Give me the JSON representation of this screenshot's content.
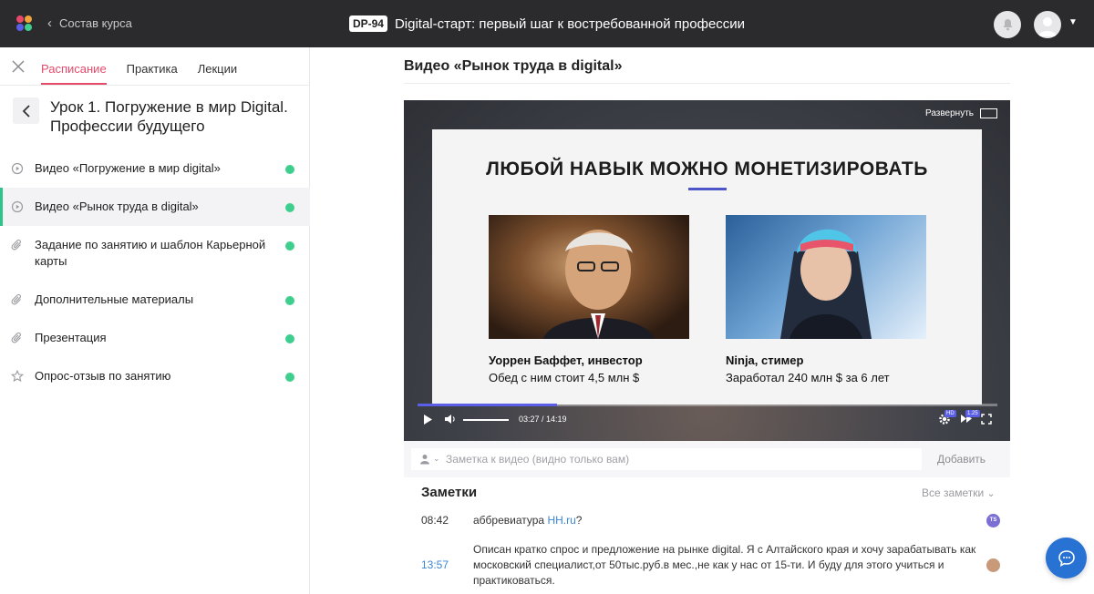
{
  "header": {
    "back_label": "Состав курса",
    "course_code": "DP-94",
    "course_title": "Digital-старт: первый шаг к востребованной профессии"
  },
  "sidebar": {
    "tabs": [
      {
        "label": "Расписание",
        "active": true
      },
      {
        "label": "Практика",
        "active": false
      },
      {
        "label": "Лекции",
        "active": false
      }
    ],
    "lesson_title": "Урок 1. Погружение в мир Digital. Профессии будущего",
    "items": [
      {
        "label": "Видео «Погружение в мир digital»",
        "icon": "play-circle-icon",
        "completed": true,
        "active": false
      },
      {
        "label": "Видео «Рынок труда в digital»",
        "icon": "play-circle-icon",
        "completed": true,
        "active": true
      },
      {
        "label": "Задание по занятию и шаблон Карьерной карты",
        "icon": "paperclip-icon",
        "completed": true,
        "active": false
      },
      {
        "label": "Дополнительные материалы",
        "icon": "paperclip-icon",
        "completed": true,
        "active": false
      },
      {
        "label": "Презентация",
        "icon": "paperclip-icon",
        "completed": true,
        "active": false
      },
      {
        "label": "Опрос-отзыв по занятию",
        "icon": "star-icon",
        "completed": true,
        "active": false
      }
    ]
  },
  "main": {
    "video_heading": "Видео «Рынок труда в digital»",
    "player": {
      "expand_label": "Развернуть",
      "slide_title": "ЛЮБОЙ НАВЫК МОЖНО МОНЕТИЗИРОВАТЬ",
      "left_caption_name": "Уоррен Баффет, инвестор",
      "left_caption_sub": "Обед с ним стоит 4,5 млн $",
      "right_caption_name": "Ninja, стимер",
      "right_caption_sub": "Заработал 240 млн $ за 6 лет",
      "time": "03:27 / 14:19",
      "progress_fraction": 0.24,
      "volume_fraction": 1.0,
      "quality_badge": "HD",
      "speed_badge": "1.25"
    },
    "note_input": {
      "placeholder": "Заметка к видео (видно только вам)",
      "value": "",
      "add_label": "Добавить"
    },
    "notes": {
      "title": "Заметки",
      "filter_label": "Все заметки",
      "items": [
        {
          "time": "08:42",
          "text_before": "аббревиатура ",
          "text_link": "HH.ru",
          "text_after": "?",
          "avatar_initials": "TS"
        },
        {
          "time": "13:57",
          "text": "Описан кратко спрос и предложение на рынке digital. Я с Алтайского края и хочу зарабатывать как московский специалист,от 50тыс.руб.в мес.,не как у нас от 15-ти. И буду для этого учиться и практиковаться."
        }
      ]
    }
  },
  "colors": {
    "topbar": "#2b2b2e",
    "accent_tab": "#e64a6b",
    "done_dot": "#3ecf8e",
    "progress": "#5b5ee6",
    "link": "#3b86d4",
    "chat_button": "#2872d3"
  }
}
